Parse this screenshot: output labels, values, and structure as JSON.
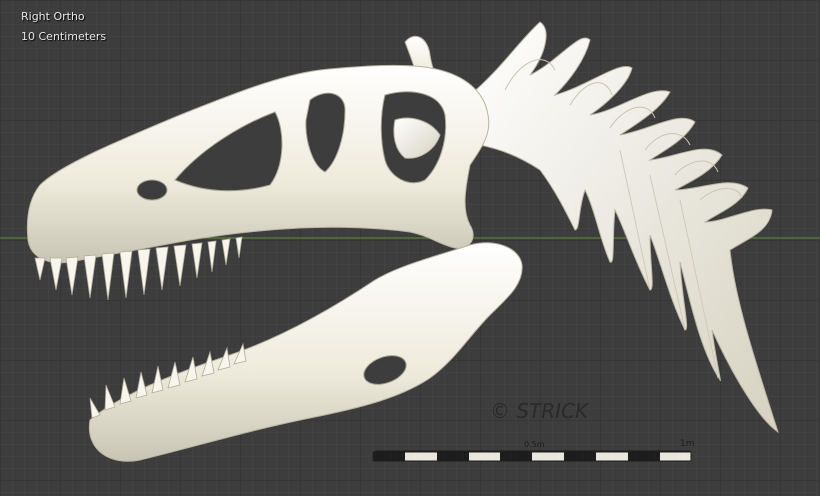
{
  "viewport": {
    "view_name": "Right Ortho",
    "grid_units": "10 Centimeters",
    "background_color": "#3d3d3d",
    "grid_minor_color": "#444444",
    "grid_major_color": "#2f2f2f",
    "x_axis_color": "#5f8f3a",
    "model_color": "#f2efe2"
  },
  "signature": {
    "text": "© STRICK"
  },
  "scale_bar": {
    "mid_label": "0.5m",
    "end_label": "1m"
  }
}
